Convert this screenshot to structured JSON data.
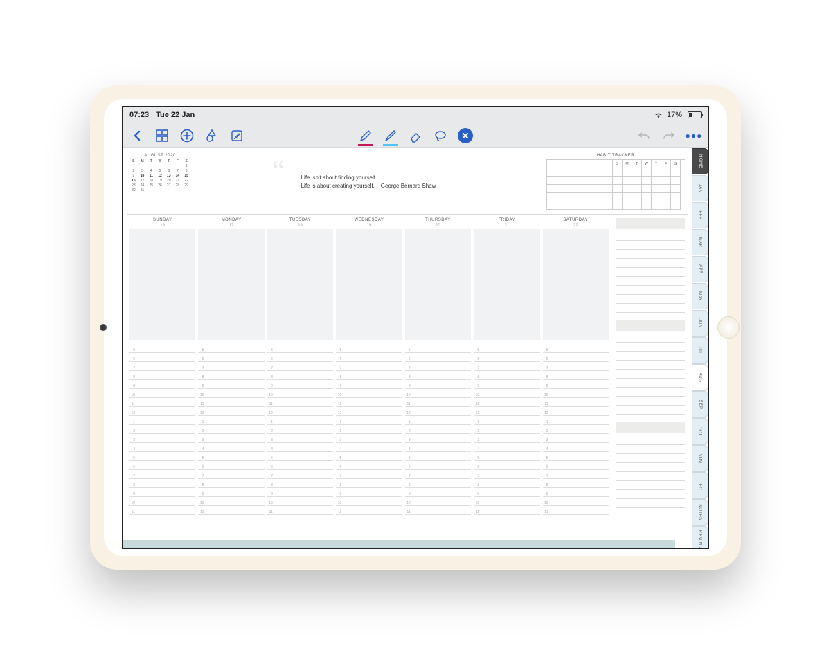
{
  "status": {
    "time": "07:23",
    "date": "Tue 22 Jan",
    "battery": "17%"
  },
  "toolbar_icons": {
    "back": "back",
    "grid": "grid",
    "add": "add",
    "shapes": "shapes",
    "edit": "edit",
    "pen": "pen",
    "highlighter": "highlighter",
    "eraser": "eraser",
    "lasso": "lasso",
    "close": "close",
    "undo": "undo",
    "redo": "redo",
    "more": "more"
  },
  "month": {
    "title": "AUGUST 2020",
    "headers": [
      "S",
      "M",
      "T",
      "W",
      "T",
      "F",
      "S"
    ],
    "cells": [
      "",
      "",
      "",
      "",
      "",
      "",
      "1",
      "2",
      "3",
      "4",
      "5",
      "6",
      "7",
      "8",
      "9",
      "10",
      "11",
      "12",
      "13",
      "14",
      "15",
      "16",
      "17",
      "18",
      "19",
      "20",
      "21",
      "22",
      "23",
      "24",
      "25",
      "26",
      "27",
      "28",
      "29",
      "30",
      "31",
      "",
      "",
      "",
      "",
      ""
    ],
    "bold_start_index": 15,
    "bold_end_index": 21
  },
  "quote": {
    "line1": "Life isn't about finding yourself.",
    "line2": "Life is about creating yourself. – George Bernard Shaw"
  },
  "habit": {
    "title": "HABIT TRACKER",
    "headers": [
      "S",
      "M",
      "T",
      "W",
      "T",
      "F",
      "S"
    ],
    "rows": 5
  },
  "week": {
    "days": [
      {
        "name": "SUNDAY",
        "date": "16"
      },
      {
        "name": "MONDAY",
        "date": "17"
      },
      {
        "name": "TUESDAY",
        "date": "18"
      },
      {
        "name": "WEDNESDAY",
        "date": "19"
      },
      {
        "name": "THURSDAY",
        "date": "20"
      },
      {
        "name": "FRIDAY",
        "date": "21"
      },
      {
        "name": "SATURDAY",
        "date": "22"
      }
    ],
    "hours": [
      "5",
      "6",
      "7",
      "8",
      "9",
      "10",
      "11",
      "12",
      "1",
      "2",
      "3",
      "4",
      "5",
      "6",
      "7",
      "8",
      "9",
      "10",
      "11"
    ]
  },
  "tabs": [
    "HOME",
    "JAN",
    "FEB",
    "MAR",
    "APR",
    "MAY",
    "JUN",
    "JUL",
    "AUG",
    "SEP",
    "OCT",
    "NOV",
    "DEC",
    "NOTES",
    "REMIND"
  ],
  "active_tab": "AUG",
  "dark_tab": "HOME"
}
